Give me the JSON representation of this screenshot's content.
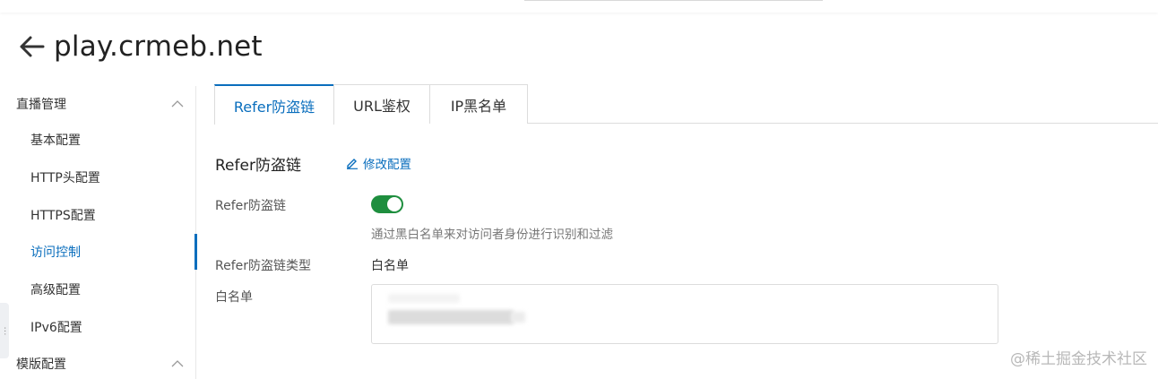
{
  "header": {
    "title": "play.crmeb.net",
    "back_icon": "arrow-left-icon"
  },
  "sidebar": {
    "groups": [
      {
        "label": "直播管理",
        "expanded": true
      },
      {
        "label": "模版配置",
        "expanded": true
      }
    ],
    "items": [
      {
        "label": "基本配置",
        "active": false
      },
      {
        "label": "HTTP头配置",
        "active": false
      },
      {
        "label": "HTTPS配置",
        "active": false
      },
      {
        "label": "访问控制",
        "active": true
      },
      {
        "label": "高级配置",
        "active": false
      },
      {
        "label": "IPv6配置",
        "active": false
      }
    ]
  },
  "tabs": [
    {
      "label": "Refer防盗链",
      "active": true
    },
    {
      "label": "URL鉴权",
      "active": false
    },
    {
      "label": "IP黑名单",
      "active": false
    }
  ],
  "section": {
    "title": "Refer防盗链",
    "edit_label": "修改配置",
    "toggle_label": "Refer防盗链",
    "toggle_on": true,
    "hint": "通过黑白名单来对访问者身份进行识别和过滤",
    "type_label": "Refer防盗链类型",
    "type_value": "白名单",
    "whitelist_label": "白名单"
  },
  "watermark": "@稀土掘金技术社区",
  "colors": {
    "accent": "#0a6ebd",
    "toggle_on": "#1e8e3e"
  }
}
